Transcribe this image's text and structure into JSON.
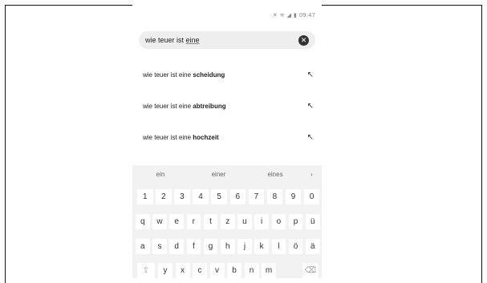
{
  "status": {
    "time": "09:47",
    "icons": [
      "mute-icon",
      "wifi-icon",
      "signal-icon",
      "battery-icon"
    ]
  },
  "search": {
    "prefix": "wie teuer ist ",
    "underlined": "eine"
  },
  "suggestions": [
    {
      "prefix": "wie teuer ist eine ",
      "bold": "scheidung"
    },
    {
      "prefix": "wie teuer ist eine ",
      "bold": "abtreibung"
    },
    {
      "prefix": "wie teuer ist eine ",
      "bold": "hochzeit"
    }
  ],
  "keyboard": {
    "predictions": [
      "ein",
      "einer",
      "eines",
      "›"
    ],
    "rows": [
      [
        "1",
        "2",
        "3",
        "4",
        "5",
        "6",
        "7",
        "8",
        "9",
        "0"
      ],
      [
        "q",
        "w",
        "e",
        "r",
        "t",
        "z",
        "u",
        "i",
        "o",
        "p",
        "ü"
      ],
      [
        "a",
        "s",
        "d",
        "f",
        "g",
        "h",
        "j",
        "k",
        "l",
        "ö",
        "ä"
      ],
      [
        "⇧",
        "y",
        "x",
        "c",
        "v",
        "b",
        "n",
        "m",
        "⌫"
      ]
    ]
  }
}
